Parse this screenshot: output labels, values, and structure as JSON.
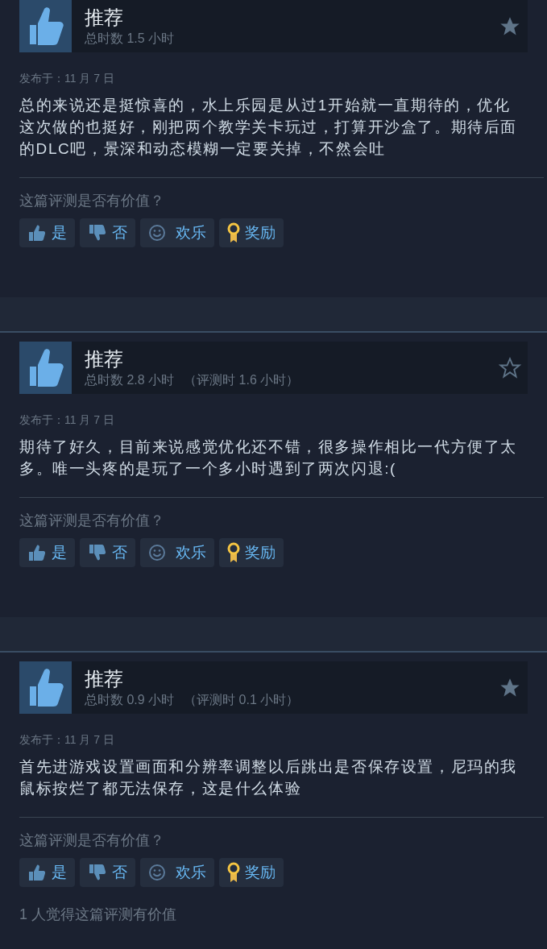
{
  "reviews": [
    {
      "verdict": "推荐",
      "hours": "总时数 1.5 小时",
      "starred": true,
      "date": "发布于：11 月 7 日",
      "text": "总的来说还是挺惊喜的，水上乐园是从过1开始就一直期待的，优化这次做的也挺好，刚把两个教学关卡玩过，打算开沙盒了。期待后面的DLC吧，景深和动态模糊一定要关掉，不然会吐",
      "question": "这篇评测是否有价值？",
      "buttons": [
        {
          "kind": "yes",
          "label": "是"
        },
        {
          "kind": "no",
          "label": "否"
        },
        {
          "kind": "funny",
          "label": "欢乐"
        },
        {
          "kind": "award",
          "label": "奖励"
        }
      ]
    },
    {
      "verdict": "推荐",
      "hours": "总时数 2.8 小时",
      "hours_at_review": "（评测时 1.6 小时）",
      "starred": false,
      "date": "发布于：11 月 7 日",
      "text": "期待了好久，目前来说感觉优化还不错，很多操作相比一代方便了太多。唯一头疼的是玩了一个多小时遇到了两次闪退:(",
      "question": "这篇评测是否有价值？",
      "buttons": [
        {
          "kind": "yes",
          "label": "是"
        },
        {
          "kind": "no",
          "label": "否"
        },
        {
          "kind": "funny",
          "label": "欢乐"
        },
        {
          "kind": "award",
          "label": "奖励"
        }
      ]
    },
    {
      "verdict": "推荐",
      "hours": "总时数 0.9 小时",
      "hours_at_review": "（评测时 0.1 小时）",
      "starred": true,
      "date": "发布于：11 月 7 日",
      "text": "首先进游戏设置画面和分辨率调整以后跳出是否保存设置，尼玛的我鼠标按烂了都无法保存，这是什么体验",
      "question": "这篇评测是否有价值？",
      "buttons": [
        {
          "kind": "yes",
          "label": "是"
        },
        {
          "kind": "no",
          "label": "否"
        },
        {
          "kind": "funny",
          "label": "欢乐"
        },
        {
          "kind": "award",
          "label": "奖励"
        }
      ],
      "helpful": "1 人觉得这篇评测有价值"
    }
  ]
}
